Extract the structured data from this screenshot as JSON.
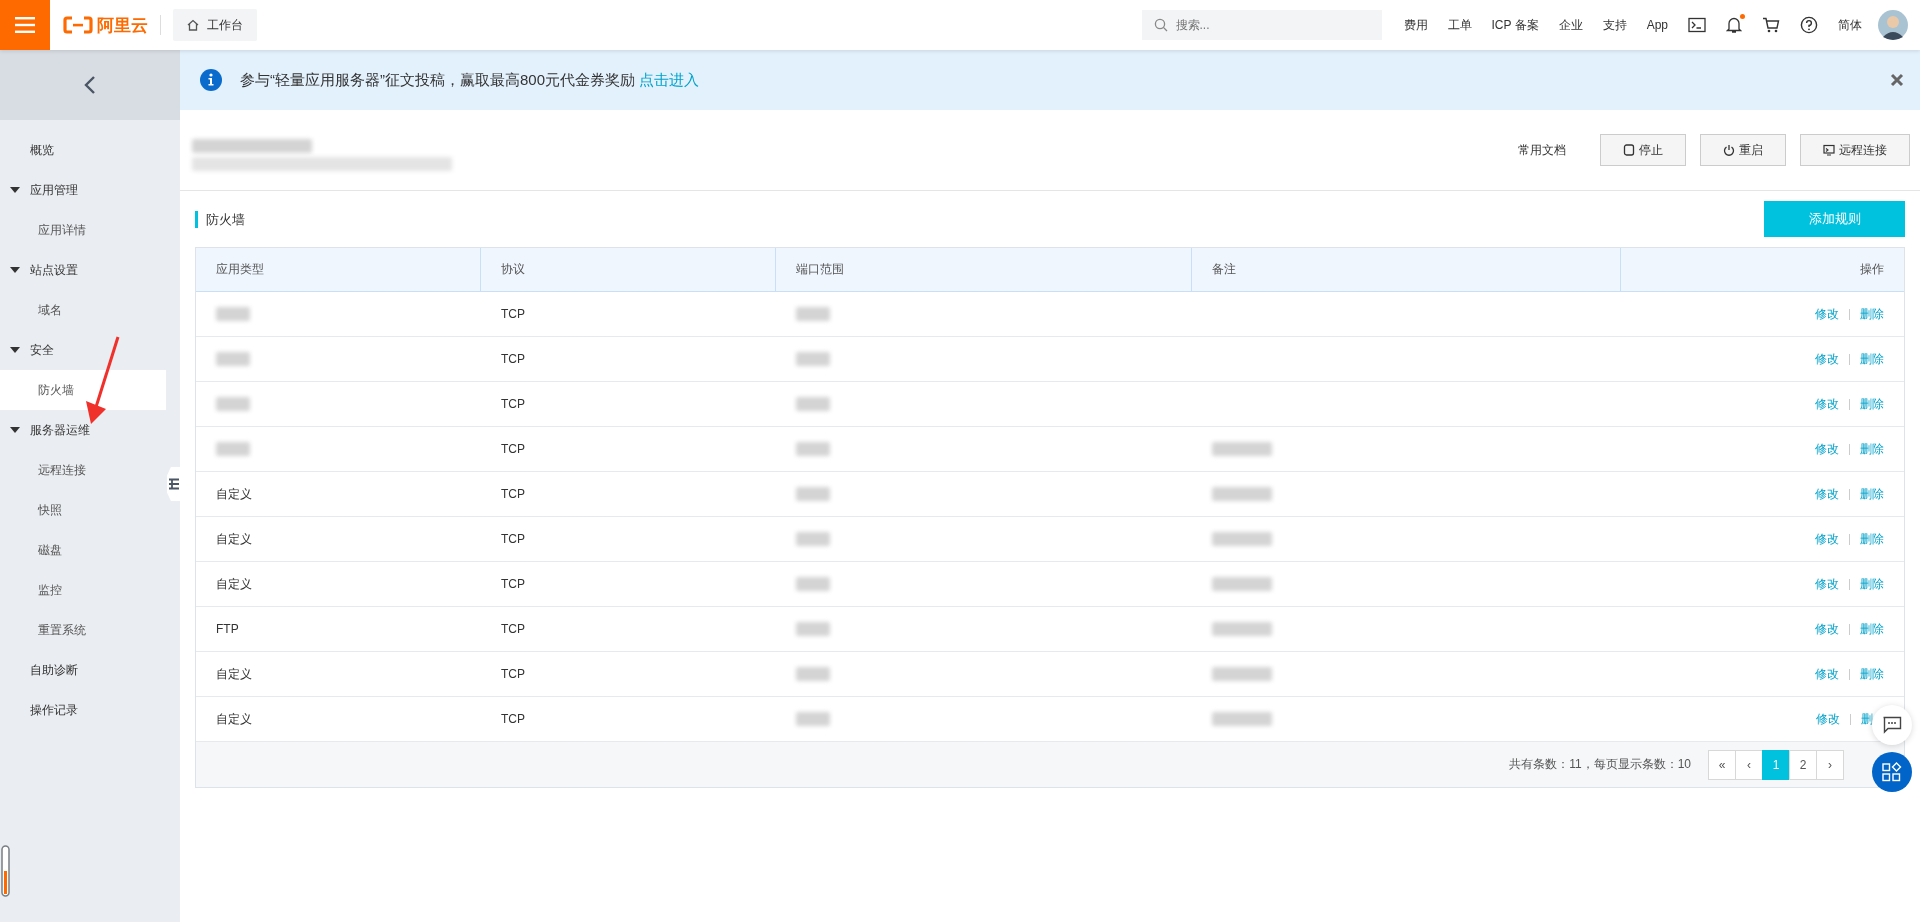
{
  "topbar": {
    "logo": "阿里云",
    "workbench": "工作台",
    "search": {
      "placeholder": "搜索..."
    },
    "links": [
      "费用",
      "工单",
      "ICP 备案",
      "企业",
      "支持",
      "App"
    ],
    "notification_dot": true,
    "language": "简体"
  },
  "sidebar": {
    "items": [
      {
        "label": "概览",
        "selected": false
      },
      {
        "label": "应用管理",
        "expanded": true,
        "children": [
          {
            "label": "应用详情",
            "selected": false
          }
        ]
      },
      {
        "label": "站点设置",
        "expanded": true,
        "children": [
          {
            "label": "域名",
            "selected": false
          }
        ]
      },
      {
        "label": "安全",
        "expanded": true,
        "children": [
          {
            "label": "防火墙",
            "selected": true
          }
        ]
      },
      {
        "label": "服务器运维",
        "expanded": true,
        "children": [
          {
            "label": "远程连接",
            "selected": false
          },
          {
            "label": "快照",
            "selected": false
          },
          {
            "label": "磁盘",
            "selected": false
          },
          {
            "label": "监控",
            "selected": false
          },
          {
            "label": "重置系统",
            "selected": false
          }
        ]
      },
      {
        "label": "自助诊断",
        "selected": false
      },
      {
        "label": "操作记录",
        "selected": false
      }
    ]
  },
  "banner": {
    "text": "参与“轻量应用服务器”征文投稿，赢取最高800元代金券奖励",
    "link": "点击进入"
  },
  "header": {
    "title_redacted": true,
    "docs_label": "常用文档",
    "buttons": [
      "停止",
      "重启",
      "远程连接"
    ]
  },
  "section": {
    "title": "防火墙",
    "add_button": "添加规则"
  },
  "table": {
    "columns": [
      "应用类型",
      "协议",
      "端口范围",
      "备注",
      "操作"
    ],
    "rows": [
      {
        "type_redacted": true,
        "protocol": "TCP",
        "port_redacted": true,
        "note_redacted": false,
        "actions": [
          "修改",
          "删除"
        ]
      },
      {
        "type_redacted": true,
        "protocol": "TCP",
        "port_redacted": true,
        "note_redacted": false,
        "actions": [
          "修改",
          "删除"
        ]
      },
      {
        "type_redacted": true,
        "protocol": "TCP",
        "port_redacted": true,
        "note_redacted": false,
        "actions": [
          "修改",
          "删除"
        ]
      },
      {
        "type_redacted": true,
        "protocol": "TCP",
        "port_redacted": true,
        "note_redacted": true,
        "actions": [
          "修改",
          "删除"
        ]
      },
      {
        "type": "自定义",
        "type_redacted": false,
        "protocol": "TCP",
        "port_redacted": true,
        "note_redacted": true,
        "actions": [
          "修改",
          "删除"
        ]
      },
      {
        "type": "自定义",
        "type_redacted": false,
        "protocol": "TCP",
        "port_redacted": true,
        "note_redacted": true,
        "actions": [
          "修改",
          "删除"
        ]
      },
      {
        "type": "自定义",
        "type_redacted": false,
        "protocol": "TCP",
        "port_redacted": true,
        "note_redacted": true,
        "actions": [
          "修改",
          "删除"
        ]
      },
      {
        "type": "FTP",
        "type_redacted": false,
        "protocol": "TCP",
        "port_redacted": true,
        "note_redacted": true,
        "actions": [
          "修改",
          "删除"
        ]
      },
      {
        "type": "自定义",
        "type_redacted": false,
        "protocol": "TCP",
        "port_redacted": true,
        "note_redacted": true,
        "actions": [
          "修改",
          "删除"
        ]
      },
      {
        "type": "自定义",
        "type_redacted": false,
        "protocol": "TCP",
        "port_redacted": true,
        "note_redacted": true,
        "actions": [
          "修改",
          "删"
        ]
      }
    ]
  },
  "pagination": {
    "summary": "共有条数：11，每页显示条数：10",
    "pages": [
      {
        "label": "«",
        "selected": false
      },
      {
        "label": "‹",
        "selected": false
      },
      {
        "label": "1",
        "selected": true
      },
      {
        "label": "2",
        "selected": false
      },
      {
        "label": "›",
        "selected": false
      }
    ]
  }
}
